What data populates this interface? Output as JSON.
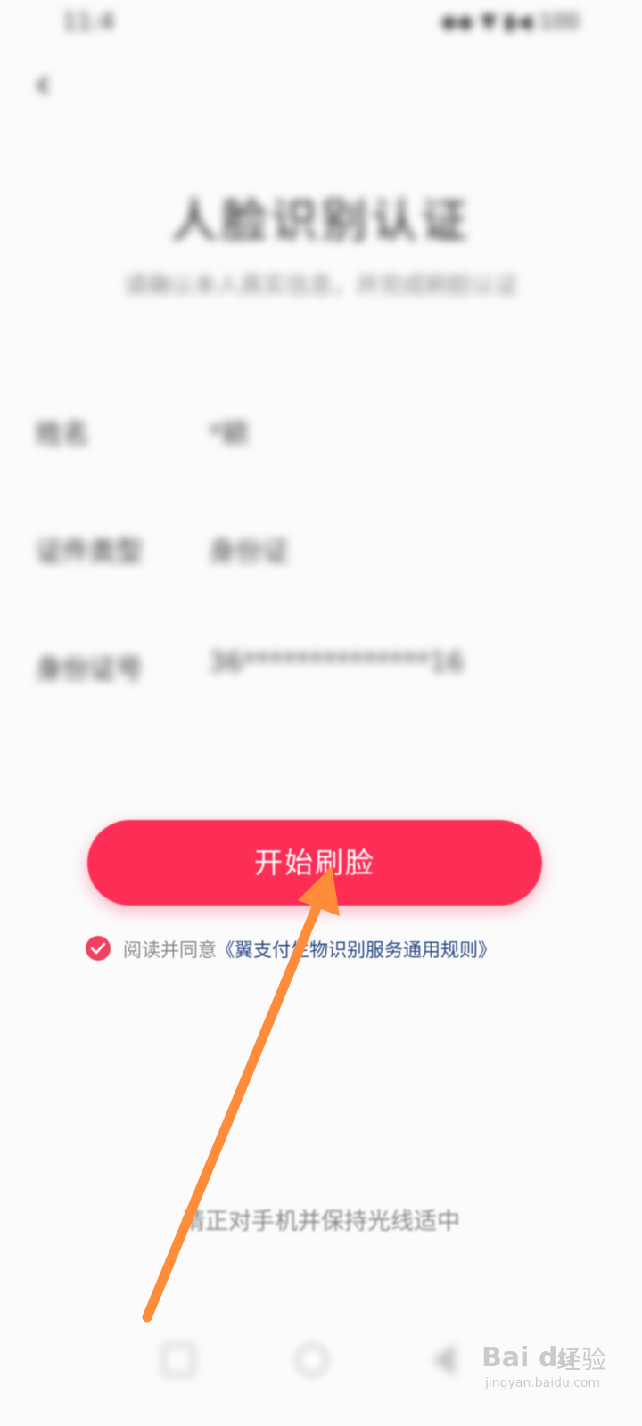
{
  "status_bar": {
    "time": "11:4",
    "icons": "◆◆ ▼ ▮◀ 100"
  },
  "header": {
    "back_icon": "chevron-left",
    "title": "人脸识别认证",
    "subtitle": "请确认本人真实信息，并完成刷脸认证"
  },
  "info": [
    {
      "label": "姓名",
      "value": "*颖"
    },
    {
      "label": "证件类型",
      "value": "身份证"
    },
    {
      "label": "身份证号",
      "value": "36**************16"
    }
  ],
  "start_button": {
    "label": "开始刷脸"
  },
  "agreement": {
    "checked": true,
    "prefix": "阅读并同意",
    "link": "《翼支付生物识别服务通用规则》"
  },
  "hint": "请正对手机并保持光线适中",
  "colors": {
    "accent": "#fc2e56",
    "link": "#2d4a86",
    "annotation_arrow": "#ff8c3b"
  },
  "watermark": {
    "logo": "Bai du",
    "name": "经验",
    "url": "jingyan.baidu.com"
  }
}
